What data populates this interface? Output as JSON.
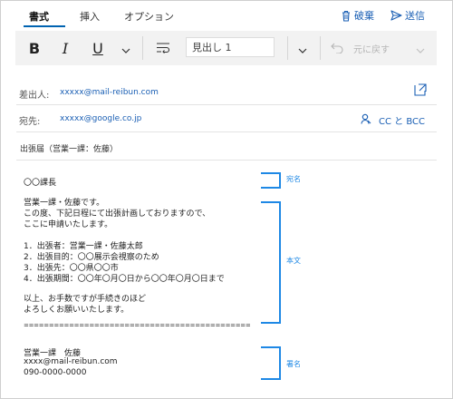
{
  "tabs": [
    {
      "label": "書式",
      "active": true
    },
    {
      "label": "挿入",
      "active": false
    },
    {
      "label": "オプション",
      "active": false
    }
  ],
  "actions": {
    "discard_label": "破棄",
    "send_label": "送信"
  },
  "toolbar": {
    "bold_label": "B",
    "italic_label": "I",
    "underline_label": "U",
    "style_value": "見出し 1",
    "undo_label": "元に戻す"
  },
  "fields": {
    "from_label": "差出人:",
    "from_value": "xxxxx@mail-reibun.com",
    "to_label": "宛先:",
    "to_value": "xxxxx@google.co.jp",
    "cc_label": "CC と BCC"
  },
  "subject": "出張届（営業一課：佐藤）",
  "body": {
    "addressee": "〇〇課長",
    "lines": [
      "営業一課・佐藤です。",
      "この度、下記日程にて出張計画しておりますので、",
      "ここに申請いたします。",
      "",
      "1．出張者：営業一課・佐藤太郎",
      "2．出張目的：〇〇展示会視察のため",
      "3．出張先：〇〇県〇〇市",
      "4．出張期間：〇〇年〇月〇日から〇〇年〇月〇日まで",
      "",
      "以上、お手数ですが手続きのほど",
      "よろしくお願いいたします。"
    ],
    "separator": "=============================================",
    "signature": [
      "営業一課　佐藤",
      "xxxx@mail-reibun.com",
      "090-0000-0000"
    ]
  },
  "annotations": {
    "addressee": "宛名",
    "body": "本文",
    "signature": "署名"
  },
  "colors": {
    "accent": "#1a5fb4",
    "annotation": "#1e88e5"
  }
}
